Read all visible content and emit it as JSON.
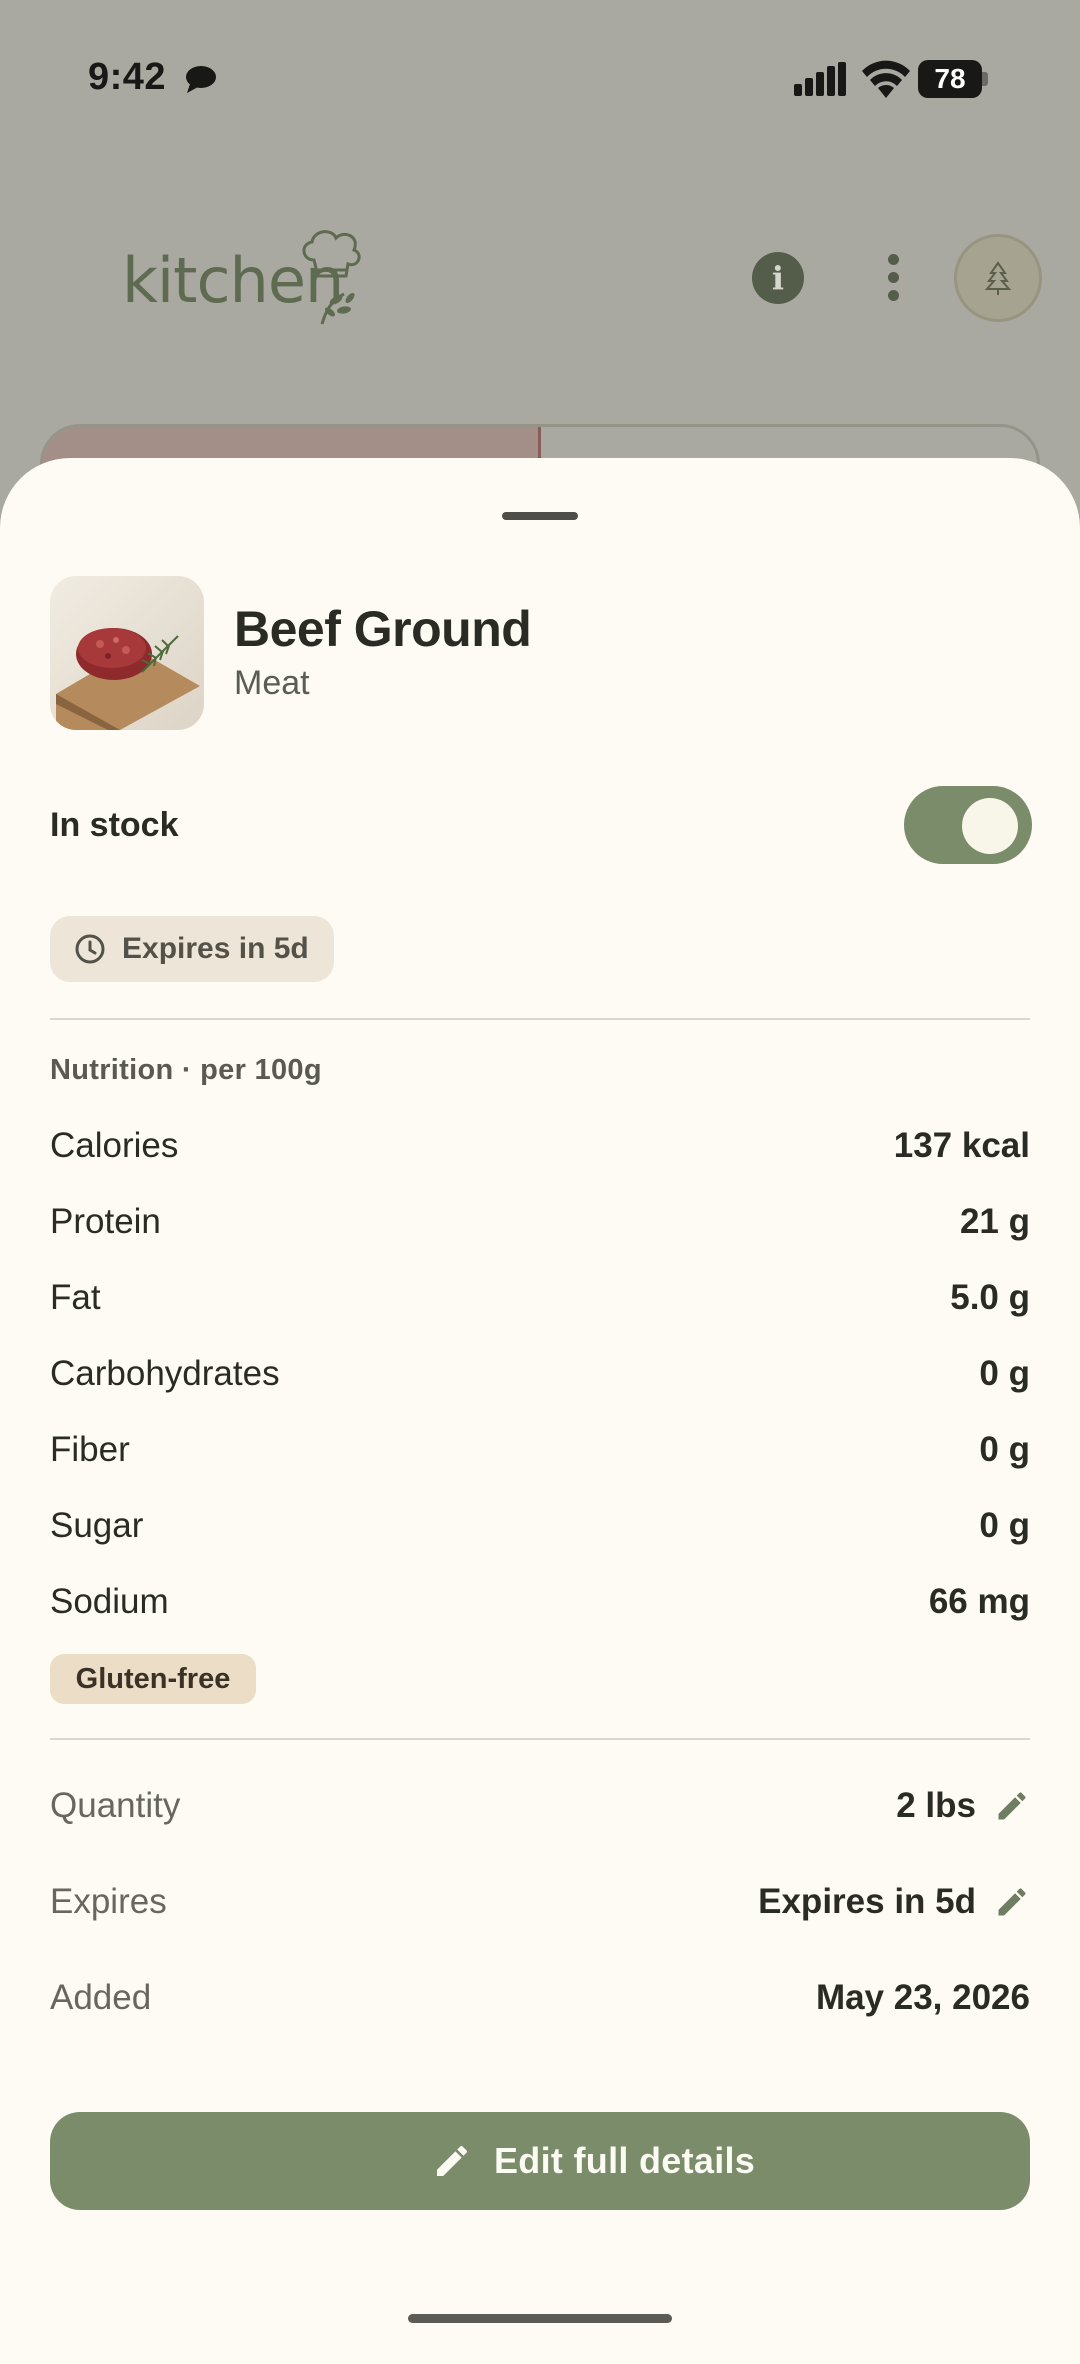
{
  "status_bar": {
    "time": "9:42",
    "battery": "78"
  },
  "app": {
    "brand": "kitchen"
  },
  "sheet": {
    "product": {
      "name": "Beef Ground",
      "category": "Meat"
    },
    "stock": {
      "label": "In stock",
      "enabled": true
    },
    "expires_chip": "Expires in 5d",
    "nutrition": {
      "title": "Nutrition · per 100g",
      "rows": [
        {
          "label": "Calories",
          "value": "137 kcal"
        },
        {
          "label": "Protein",
          "value": "21 g"
        },
        {
          "label": "Fat",
          "value": "5.0 g"
        },
        {
          "label": "Carbohydrates",
          "value": "0 g"
        },
        {
          "label": "Fiber",
          "value": "0 g"
        },
        {
          "label": "Sugar",
          "value": "0 g"
        },
        {
          "label": "Sodium",
          "value": "66 mg"
        }
      ]
    },
    "tags": [
      "Gluten-free"
    ],
    "details": {
      "quantity": {
        "label": "Quantity",
        "value": "2 lbs"
      },
      "expires": {
        "label": "Expires",
        "value": "Expires in 5d"
      },
      "added": {
        "label": "Added",
        "value": "May 23, 2026"
      }
    },
    "edit_button": "Edit full details"
  },
  "colors": {
    "accent": "#7a8c6a",
    "sheet_background": "#fdfbf3",
    "scrim": "#a9a8a1"
  },
  "icons": {
    "status": [
      "chat-bubble-icon",
      "signal-icon",
      "wifi-icon",
      "battery-icon"
    ],
    "header": [
      "info-icon",
      "more-vert-icon",
      "avatar-tree-icon"
    ],
    "sheet": [
      "clock-icon",
      "pencil-icon"
    ]
  }
}
